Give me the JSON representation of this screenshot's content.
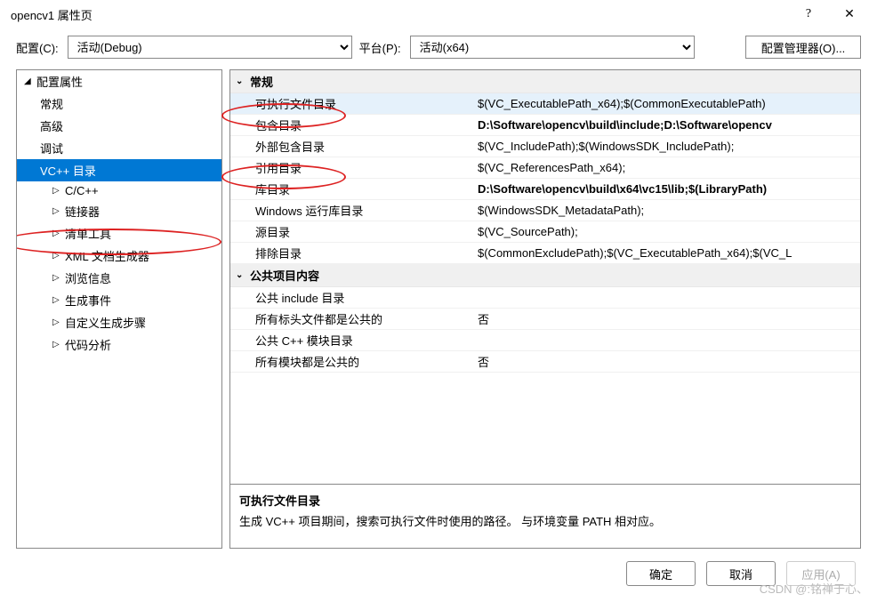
{
  "window": {
    "title": "opencv1 属性页"
  },
  "topbar": {
    "config_label": "配置(C):",
    "config_value": "活动(Debug)",
    "platform_label": "平台(P):",
    "platform_value": "活动(x64)",
    "manager_button": "配置管理器(O)..."
  },
  "tree": {
    "root": "配置属性",
    "items": [
      {
        "label": "常规"
      },
      {
        "label": "高级"
      },
      {
        "label": "调试"
      },
      {
        "label": "VC++ 目录",
        "selected": true
      },
      {
        "label": "C/C++",
        "expandable": true
      },
      {
        "label": "链接器",
        "expandable": true
      },
      {
        "label": "清单工具",
        "expandable": true
      },
      {
        "label": "XML 文档生成器",
        "expandable": true
      },
      {
        "label": "浏览信息",
        "expandable": true
      },
      {
        "label": "生成事件",
        "expandable": true
      },
      {
        "label": "自定义生成步骤",
        "expandable": true
      },
      {
        "label": "代码分析",
        "expandable": true
      }
    ]
  },
  "props": {
    "groups": [
      {
        "header": "常规",
        "rows": [
          {
            "name": "可执行文件目录",
            "value": "$(VC_ExecutablePath_x64);$(CommonExecutablePath)",
            "sel": true
          },
          {
            "name": "包含目录",
            "value": "D:\\Software\\opencv\\build\\include;D:\\Software\\opencv",
            "bold": true
          },
          {
            "name": "外部包含目录",
            "value": "$(VC_IncludePath);$(WindowsSDK_IncludePath);"
          },
          {
            "name": "引用目录",
            "value": "$(VC_ReferencesPath_x64);"
          },
          {
            "name": "库目录",
            "value": "D:\\Software\\opencv\\build\\x64\\vc15\\lib;$(LibraryPath)",
            "bold": true
          },
          {
            "name": "Windows 运行库目录",
            "value": "$(WindowsSDK_MetadataPath);"
          },
          {
            "name": "源目录",
            "value": "$(VC_SourcePath);"
          },
          {
            "name": "排除目录",
            "value": "$(CommonExcludePath);$(VC_ExecutablePath_x64);$(VC_L"
          }
        ]
      },
      {
        "header": "公共项目内容",
        "rows": [
          {
            "name": "公共 include 目录",
            "value": ""
          },
          {
            "name": "所有标头文件都是公共的",
            "value": "否"
          },
          {
            "name": "公共 C++ 模块目录",
            "value": ""
          },
          {
            "name": "所有模块都是公共的",
            "value": "否"
          }
        ]
      }
    ]
  },
  "description": {
    "title": "可执行文件目录",
    "body": "生成 VC++ 项目期间，搜索可执行文件时使用的路径。 与环境变量 PATH 相对应。"
  },
  "footer": {
    "ok": "确定",
    "cancel": "取消",
    "apply": "应用(A)"
  },
  "watermark": "CSDN @:铭禅于心、"
}
